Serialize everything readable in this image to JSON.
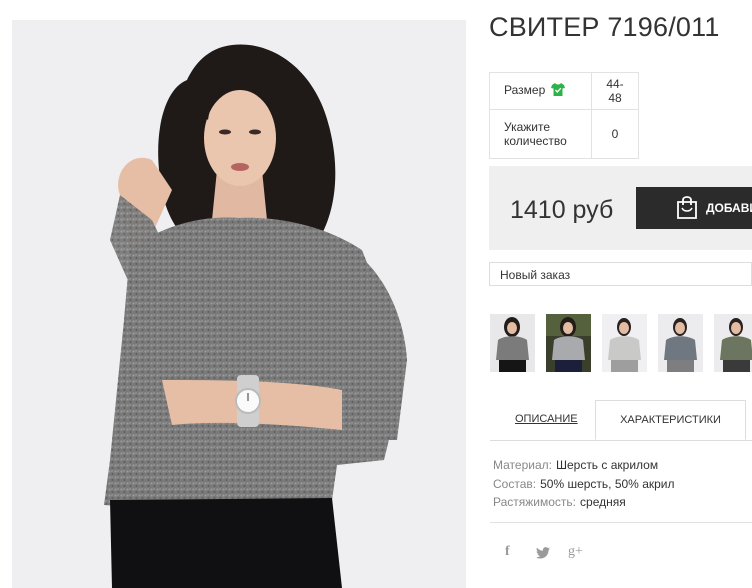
{
  "product": {
    "title": "СВИТЕР 7196/011",
    "photo_alt": "Model wearing grey knit sweater"
  },
  "specs": {
    "size_label": "Размер",
    "size_icon": "tshirt-icon",
    "size_value": "44-48",
    "qty_label_line1": "Укажите",
    "qty_label_line2": "количество",
    "qty_value": "0"
  },
  "buy": {
    "price": "1410 руб",
    "button_label": "ДОБАВИ",
    "button_icon": "shopping-bag-icon"
  },
  "order_select": {
    "selected": "Новый заказ"
  },
  "thumbnails": [
    {
      "name": "grey-sweater"
    },
    {
      "name": "light-grey-sweater"
    },
    {
      "name": "light-sweater"
    },
    {
      "name": "blue-grey-sweater"
    },
    {
      "name": "olive-sweater"
    }
  ],
  "tabs": {
    "description": "ОПИСАНИЕ",
    "characteristics": "ХАРАКТЕРИСТИКИ"
  },
  "properties": [
    {
      "key": "Материал:",
      "value": "Шерсть с акрилом"
    },
    {
      "key": "Состав:",
      "value": "50% шерсть, 50% акрил"
    },
    {
      "key": "Растяжимость:",
      "value": "средняя"
    }
  ],
  "social": {
    "facebook": "f",
    "twitter": "twitter-icon",
    "googleplus": "g+"
  },
  "colors": {
    "button_bg": "#2b2b2b",
    "tshirt_icon": "#2bb34a",
    "buy_box_bg": "#efefef"
  }
}
